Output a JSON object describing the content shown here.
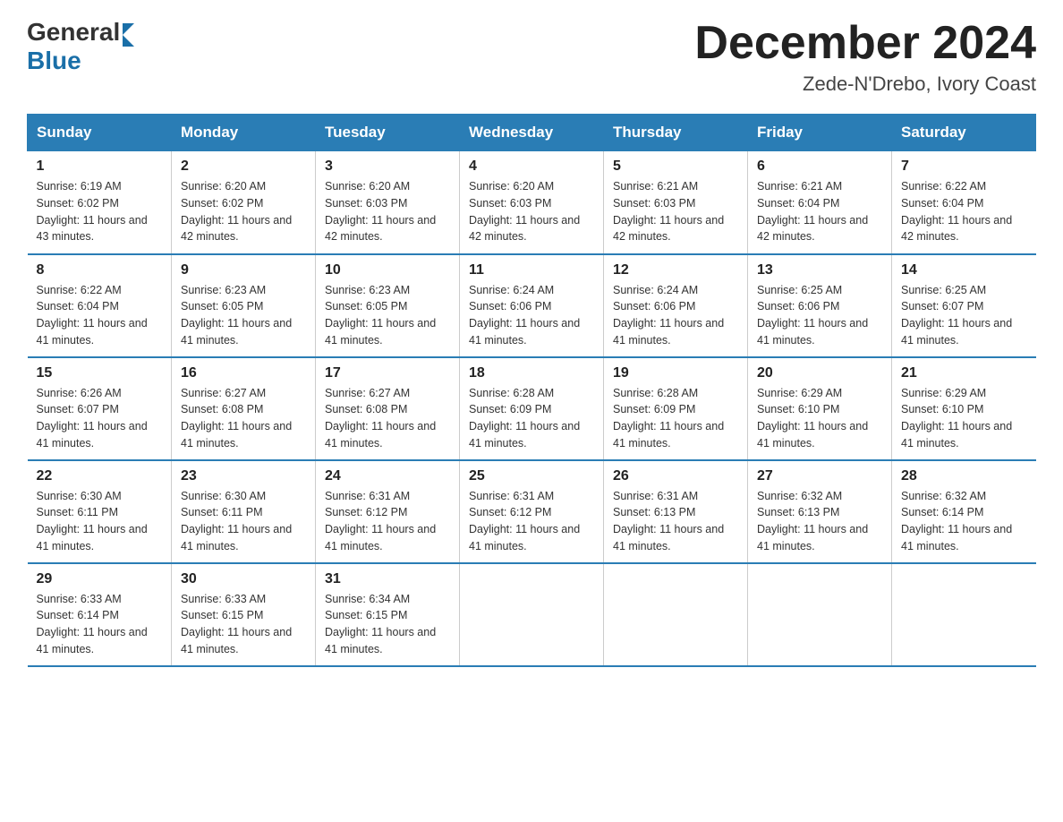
{
  "logo": {
    "general": "General",
    "blue": "Blue"
  },
  "title": "December 2024",
  "location": "Zede-N'Drebo, Ivory Coast",
  "weekdays": [
    "Sunday",
    "Monday",
    "Tuesday",
    "Wednesday",
    "Thursday",
    "Friday",
    "Saturday"
  ],
  "weeks": [
    [
      {
        "day": "1",
        "sunrise": "6:19 AM",
        "sunset": "6:02 PM",
        "daylight": "11 hours and 43 minutes."
      },
      {
        "day": "2",
        "sunrise": "6:20 AM",
        "sunset": "6:02 PM",
        "daylight": "11 hours and 42 minutes."
      },
      {
        "day": "3",
        "sunrise": "6:20 AM",
        "sunset": "6:03 PM",
        "daylight": "11 hours and 42 minutes."
      },
      {
        "day": "4",
        "sunrise": "6:20 AM",
        "sunset": "6:03 PM",
        "daylight": "11 hours and 42 minutes."
      },
      {
        "day": "5",
        "sunrise": "6:21 AM",
        "sunset": "6:03 PM",
        "daylight": "11 hours and 42 minutes."
      },
      {
        "day": "6",
        "sunrise": "6:21 AM",
        "sunset": "6:04 PM",
        "daylight": "11 hours and 42 minutes."
      },
      {
        "day": "7",
        "sunrise": "6:22 AM",
        "sunset": "6:04 PM",
        "daylight": "11 hours and 42 minutes."
      }
    ],
    [
      {
        "day": "8",
        "sunrise": "6:22 AM",
        "sunset": "6:04 PM",
        "daylight": "11 hours and 41 minutes."
      },
      {
        "day": "9",
        "sunrise": "6:23 AM",
        "sunset": "6:05 PM",
        "daylight": "11 hours and 41 minutes."
      },
      {
        "day": "10",
        "sunrise": "6:23 AM",
        "sunset": "6:05 PM",
        "daylight": "11 hours and 41 minutes."
      },
      {
        "day": "11",
        "sunrise": "6:24 AM",
        "sunset": "6:06 PM",
        "daylight": "11 hours and 41 minutes."
      },
      {
        "day": "12",
        "sunrise": "6:24 AM",
        "sunset": "6:06 PM",
        "daylight": "11 hours and 41 minutes."
      },
      {
        "day": "13",
        "sunrise": "6:25 AM",
        "sunset": "6:06 PM",
        "daylight": "11 hours and 41 minutes."
      },
      {
        "day": "14",
        "sunrise": "6:25 AM",
        "sunset": "6:07 PM",
        "daylight": "11 hours and 41 minutes."
      }
    ],
    [
      {
        "day": "15",
        "sunrise": "6:26 AM",
        "sunset": "6:07 PM",
        "daylight": "11 hours and 41 minutes."
      },
      {
        "day": "16",
        "sunrise": "6:27 AM",
        "sunset": "6:08 PM",
        "daylight": "11 hours and 41 minutes."
      },
      {
        "day": "17",
        "sunrise": "6:27 AM",
        "sunset": "6:08 PM",
        "daylight": "11 hours and 41 minutes."
      },
      {
        "day": "18",
        "sunrise": "6:28 AM",
        "sunset": "6:09 PM",
        "daylight": "11 hours and 41 minutes."
      },
      {
        "day": "19",
        "sunrise": "6:28 AM",
        "sunset": "6:09 PM",
        "daylight": "11 hours and 41 minutes."
      },
      {
        "day": "20",
        "sunrise": "6:29 AM",
        "sunset": "6:10 PM",
        "daylight": "11 hours and 41 minutes."
      },
      {
        "day": "21",
        "sunrise": "6:29 AM",
        "sunset": "6:10 PM",
        "daylight": "11 hours and 41 minutes."
      }
    ],
    [
      {
        "day": "22",
        "sunrise": "6:30 AM",
        "sunset": "6:11 PM",
        "daylight": "11 hours and 41 minutes."
      },
      {
        "day": "23",
        "sunrise": "6:30 AM",
        "sunset": "6:11 PM",
        "daylight": "11 hours and 41 minutes."
      },
      {
        "day": "24",
        "sunrise": "6:31 AM",
        "sunset": "6:12 PM",
        "daylight": "11 hours and 41 minutes."
      },
      {
        "day": "25",
        "sunrise": "6:31 AM",
        "sunset": "6:12 PM",
        "daylight": "11 hours and 41 minutes."
      },
      {
        "day": "26",
        "sunrise": "6:31 AM",
        "sunset": "6:13 PM",
        "daylight": "11 hours and 41 minutes."
      },
      {
        "day": "27",
        "sunrise": "6:32 AM",
        "sunset": "6:13 PM",
        "daylight": "11 hours and 41 minutes."
      },
      {
        "day": "28",
        "sunrise": "6:32 AM",
        "sunset": "6:14 PM",
        "daylight": "11 hours and 41 minutes."
      }
    ],
    [
      {
        "day": "29",
        "sunrise": "6:33 AM",
        "sunset": "6:14 PM",
        "daylight": "11 hours and 41 minutes."
      },
      {
        "day": "30",
        "sunrise": "6:33 AM",
        "sunset": "6:15 PM",
        "daylight": "11 hours and 41 minutes."
      },
      {
        "day": "31",
        "sunrise": "6:34 AM",
        "sunset": "6:15 PM",
        "daylight": "11 hours and 41 minutes."
      },
      null,
      null,
      null,
      null
    ]
  ],
  "labels": {
    "sunrise": "Sunrise:",
    "sunset": "Sunset:",
    "daylight": "Daylight:"
  }
}
